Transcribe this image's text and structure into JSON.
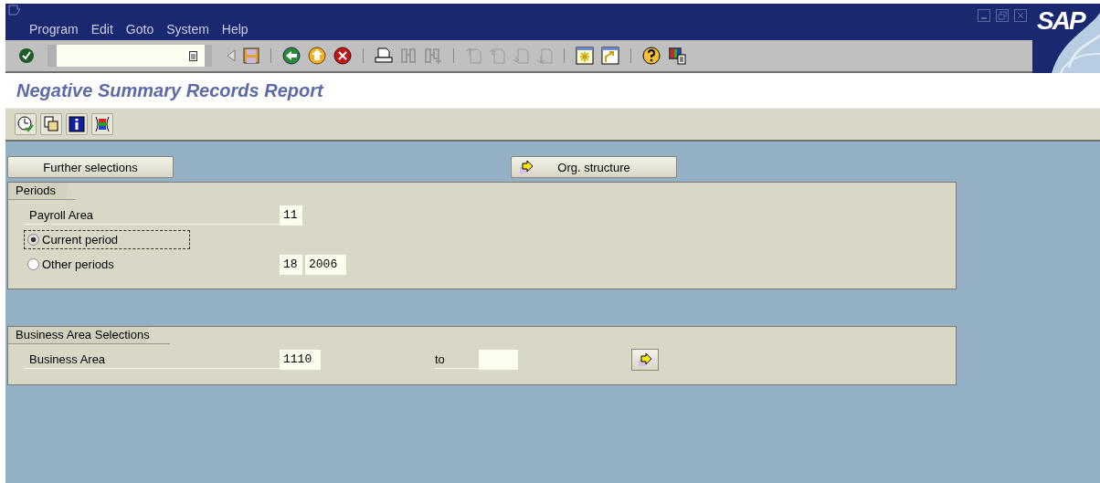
{
  "menu": [
    {
      "label": "Program"
    },
    {
      "label": "Edit"
    },
    {
      "label": "Goto"
    },
    {
      "label": "System"
    },
    {
      "label": "Help"
    }
  ],
  "logo": "SAP",
  "title": "Negative Summary Records Report",
  "buttons": [
    {
      "kind": "plain",
      "label": "Further selections"
    },
    {
      "kind": "arrow",
      "label": "Org. structure"
    }
  ],
  "periods": {
    "title": "Periods",
    "rows": [
      {
        "kind": "field",
        "label": "Payroll Area",
        "values": [
          "11"
        ]
      },
      {
        "kind": "radio",
        "label": "Current period",
        "selected": true,
        "focused": true
      },
      {
        "kind": "radio",
        "label": "Other periods",
        "selected": false,
        "focused": false,
        "values": [
          "18",
          "2006"
        ]
      }
    ]
  },
  "business": {
    "title": "Business Area Selections",
    "rows": [
      {
        "kind": "range",
        "label": "Business Area",
        "values": [
          "1110"
        ],
        "to_label": "to"
      }
    ]
  }
}
